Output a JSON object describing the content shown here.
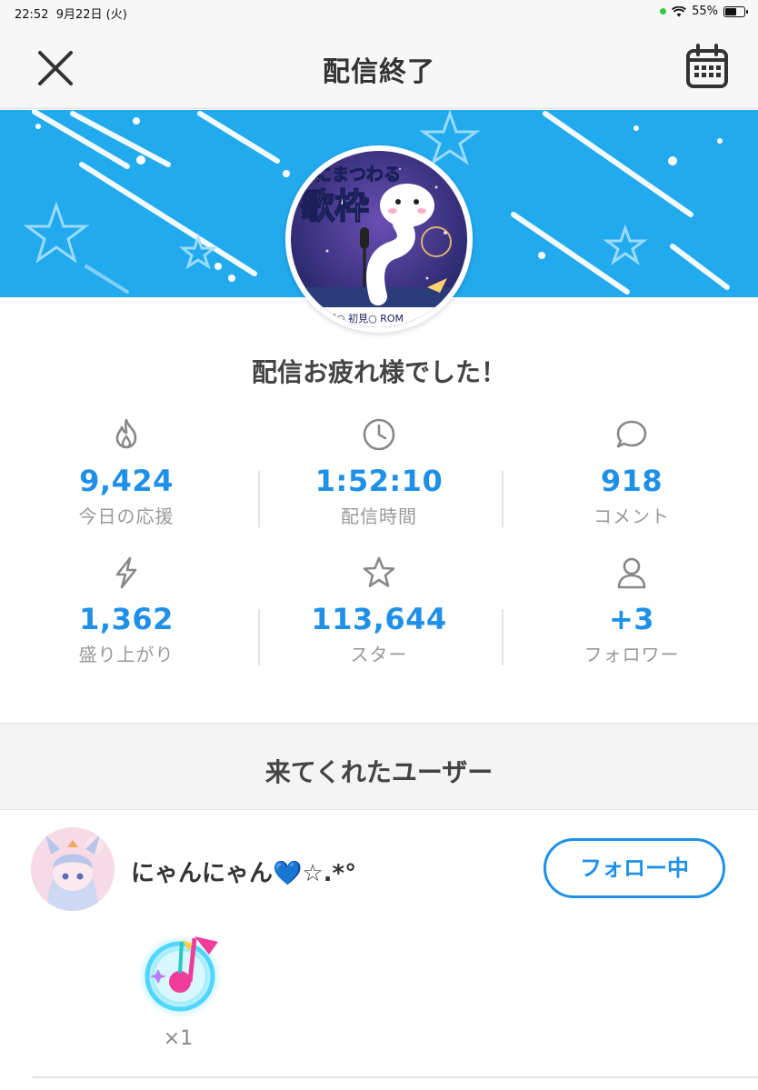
{
  "status_bar": {
    "time": "22:52",
    "date": "9月22日 (火)",
    "battery": "55%",
    "battery_level": 0.55
  },
  "nav": {
    "title": "配信終了",
    "close_icon": "close-icon",
    "calendar_icon": "calendar-icon"
  },
  "banner": {
    "color": "#22aaee",
    "thumbnail_text_1": "にまつわる",
    "thumbnail_text_2": "歌枠"
  },
  "thanks_message": "配信お疲れ様でした！",
  "stats": [
    {
      "icon": "flame-icon",
      "value": "9,424",
      "label": "今日の応援"
    },
    {
      "icon": "clock-icon",
      "value": "1:52:10",
      "label": "配信時間"
    },
    {
      "icon": "comment-icon",
      "value": "918",
      "label": "コメント"
    },
    {
      "icon": "lightning-icon",
      "value": "1,362",
      "label": "盛り上がり"
    },
    {
      "icon": "star-icon",
      "value": "113,644",
      "label": "スター"
    },
    {
      "icon": "person-icon",
      "value": "+3",
      "label": "フォロワー"
    }
  ],
  "visitors": {
    "heading": "来てくれたユーザー",
    "users": [
      {
        "name": "にゃんにゃん💙☆.*°",
        "follow_label": "フォロー中",
        "gift_count": "×1"
      }
    ]
  },
  "colors": {
    "accent": "#1e90e8",
    "banner": "#22aaee"
  }
}
